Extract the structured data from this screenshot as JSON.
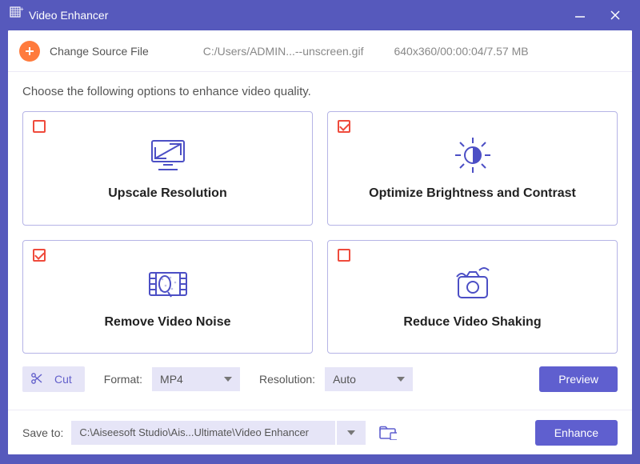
{
  "window": {
    "title": "Video Enhancer"
  },
  "source": {
    "change_label": "Change Source File",
    "path": "C:/Users/ADMIN...--unscreen.gif",
    "info": "640x360/00:00:04/7.57 MB"
  },
  "instruction": "Choose the following options to enhance video quality.",
  "options": {
    "upscale": {
      "label": "Upscale Resolution",
      "checked": false
    },
    "brightness": {
      "label": "Optimize Brightness and Contrast",
      "checked": true
    },
    "noise": {
      "label": "Remove Video Noise",
      "checked": true
    },
    "shaking": {
      "label": "Reduce Video Shaking",
      "checked": false
    }
  },
  "controls": {
    "cut_label": "Cut",
    "format_label": "Format:",
    "format_value": "MP4",
    "resolution_label": "Resolution:",
    "resolution_value": "Auto",
    "preview_label": "Preview"
  },
  "footer": {
    "save_label": "Save to:",
    "save_path": "C:\\Aiseesoft Studio\\Ais...Ultimate\\Video Enhancer",
    "enhance_label": "Enhance"
  }
}
